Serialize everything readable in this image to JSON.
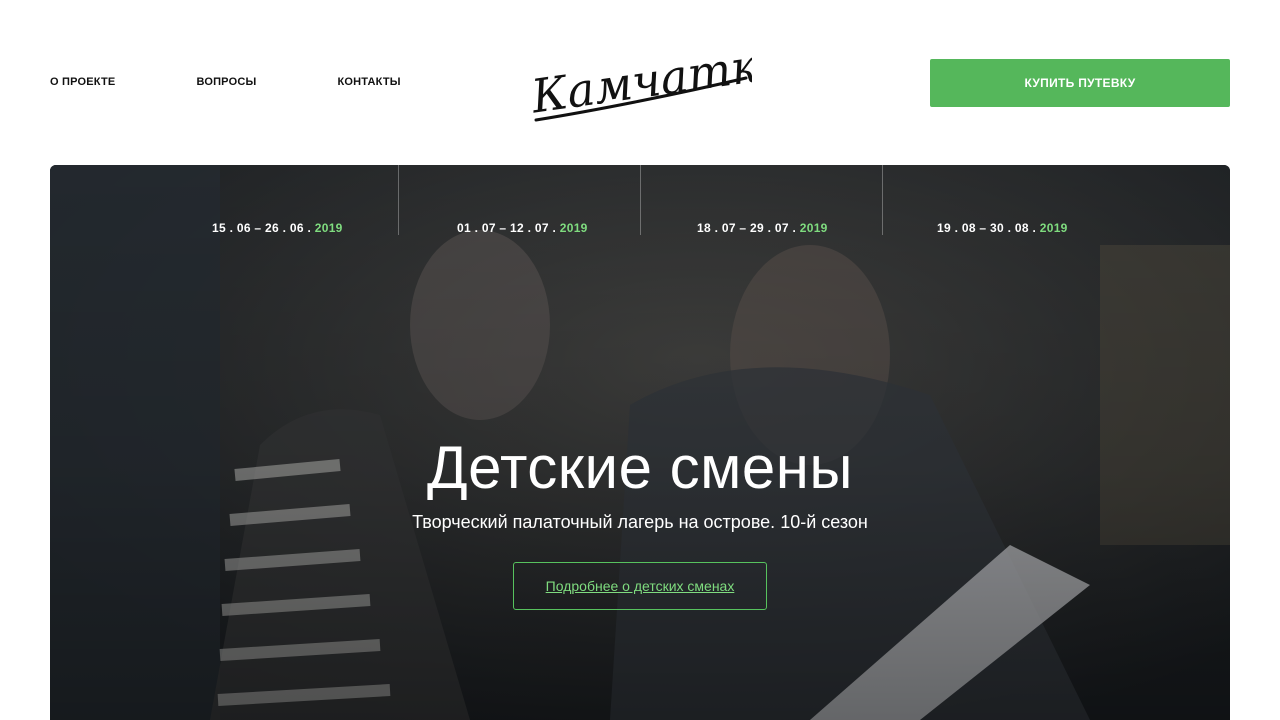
{
  "nav": {
    "items": [
      {
        "label": "О ПРОЕКТЕ"
      },
      {
        "label": "ВОПРОСЫ"
      },
      {
        "label": "КОНТАКТЫ"
      }
    ]
  },
  "logo": {
    "text": "Камчатка"
  },
  "header": {
    "buy_label": "КУПИТЬ ПУТЕВКУ"
  },
  "hero": {
    "sessions": [
      {
        "range": "15 . 06 – 26 . 06 .",
        "year": "2019"
      },
      {
        "range": "01 . 07 – 12 . 07 .",
        "year": "2019"
      },
      {
        "range": "18 . 07 – 29 . 07 .",
        "year": "2019"
      },
      {
        "range": "19 . 08 – 30 . 08 .",
        "year": "2019"
      }
    ],
    "title": "Детские смены",
    "subtitle": "Творческий палаточный лагерь на острове. 10-й сезон",
    "cta_label": "Подробнее о детских сменах"
  },
  "colors": {
    "accent": "#55b75b",
    "year_highlight": "#7fdc7f"
  }
}
